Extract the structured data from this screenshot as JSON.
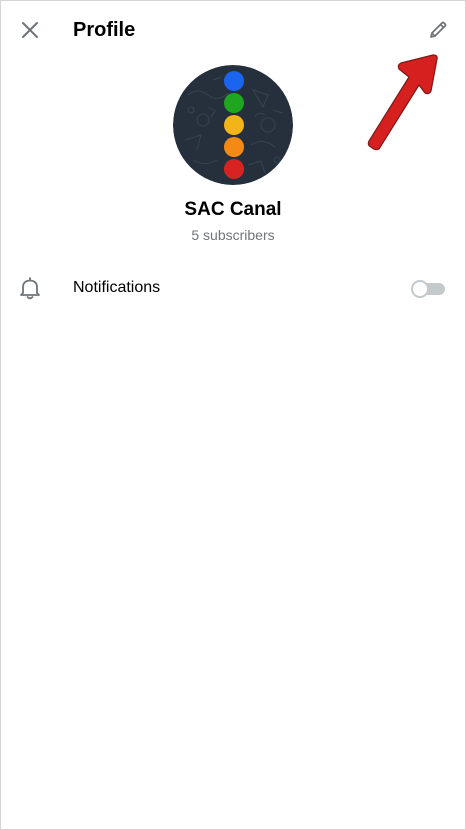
{
  "header": {
    "title": "Profile",
    "close_icon": "close-icon",
    "edit_icon": "pencil-icon"
  },
  "profile": {
    "name": "SAC Canal",
    "subscribers": "5 subscribers",
    "avatar_dot_colors": [
      "#1a64f0",
      "#1fa51f",
      "#f2b416",
      "#f48a15",
      "#d92323"
    ],
    "avatar_background": "#26303d"
  },
  "settings": {
    "notifications_label": "Notifications",
    "notifications_enabled": false,
    "bell_icon": "bell-icon"
  },
  "annotation": {
    "arrow_color": "#d61f1f"
  }
}
